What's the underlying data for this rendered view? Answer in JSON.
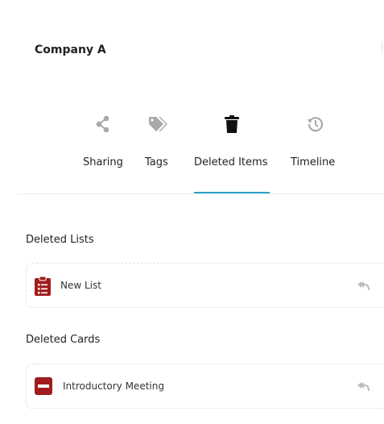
{
  "header": {
    "title": "Company A"
  },
  "tabs": [
    {
      "label": "Sharing",
      "icon": "share-icon"
    },
    {
      "label": "Tags",
      "icon": "tags-icon"
    },
    {
      "label": "Deleted Items",
      "icon": "trash-icon",
      "active": true
    },
    {
      "label": "Timeline",
      "icon": "history-icon"
    }
  ],
  "colors": {
    "accent": "#27a0c8",
    "icon_muted": "#a9a9a9",
    "danger": "#a11c1c"
  },
  "deleted_lists": {
    "heading": "Deleted Lists",
    "items": [
      {
        "label": "New List",
        "icon": "clipboard-list-icon",
        "action_icon": "restore-icon"
      }
    ]
  },
  "deleted_cards": {
    "heading": "Deleted Cards",
    "items": [
      {
        "label": "Introductory Meeting",
        "icon": "card-minus-icon",
        "action_icon": "restore-icon"
      }
    ]
  }
}
